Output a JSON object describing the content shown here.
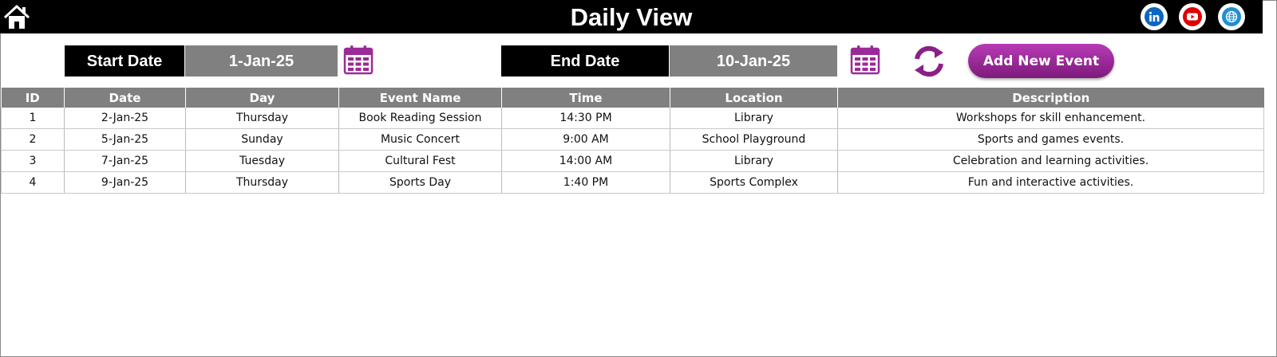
{
  "header": {
    "title": "Daily View",
    "icons": [
      "home-icon",
      "linkedin-icon",
      "youtube-icon",
      "globe-icon"
    ]
  },
  "filters": {
    "start_label": "Start Date",
    "start_value": "1-Jan-25",
    "end_label": "End Date",
    "end_value": "10-Jan-25"
  },
  "actions": {
    "add_label": "Add New Event"
  },
  "table": {
    "columns": [
      "ID",
      "Date",
      "Day",
      "Event Name",
      "Time",
      "Location",
      "Description"
    ],
    "rows": [
      [
        "1",
        "2-Jan-25",
        "Thursday",
        "Book Reading Session",
        "14:30 PM",
        "Library",
        "Workshops for skill enhancement."
      ],
      [
        "2",
        "5-Jan-25",
        "Sunday",
        "Music Concert",
        "9:00 AM",
        "School Playground",
        "Sports and games events."
      ],
      [
        "3",
        "7-Jan-25",
        "Tuesday",
        "Cultural Fest",
        "14:00 AM",
        "Library",
        "Celebration and learning activities."
      ],
      [
        "4",
        "9-Jan-25",
        "Thursday",
        "Sports Day",
        "1:40 PM",
        "Sports Complex",
        "Fun and interactive activities."
      ]
    ]
  },
  "colors": {
    "header_bg": "#000000",
    "value_bg": "#808080",
    "accent": "#9b2a99",
    "linkedin": "#0a66c2",
    "youtube": "#e00000"
  }
}
